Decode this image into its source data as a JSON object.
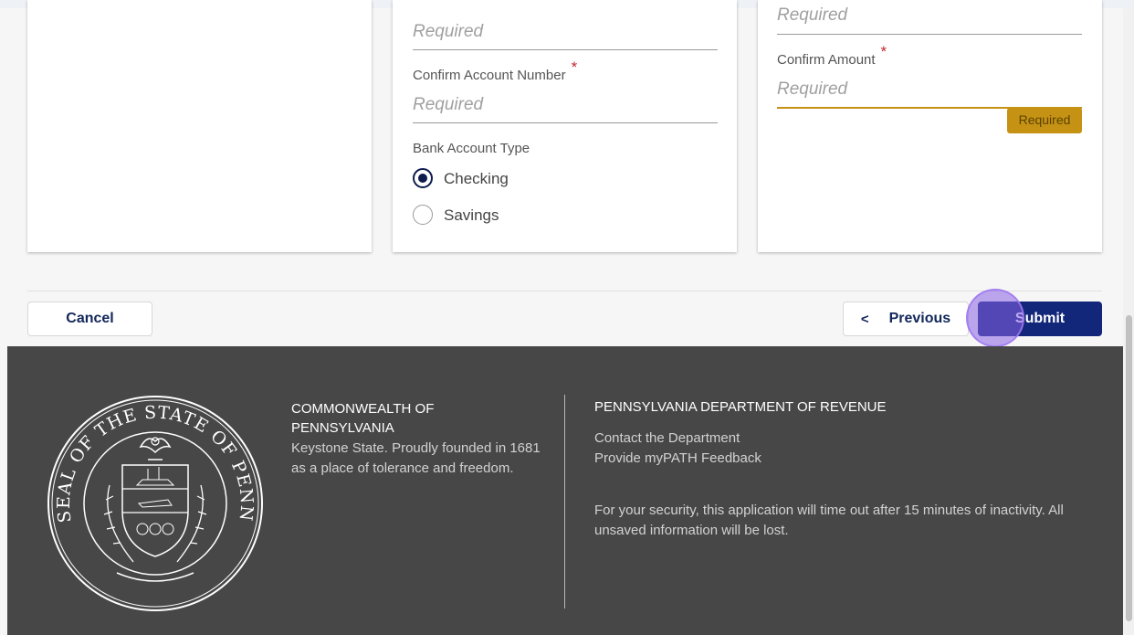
{
  "form": {
    "placeholder_required": "Required",
    "confirm_account_label": "Confirm Account Number",
    "required_star": "*",
    "account_type_label": "Bank Account Type",
    "account_types": [
      "Checking",
      "Savings"
    ],
    "account_type_selected": "Checking",
    "confirm_amount_label": "Confirm Amount",
    "error_badge": "Required"
  },
  "buttons": {
    "cancel": "Cancel",
    "previous": "Previous",
    "submit": "Submit"
  },
  "icons": {
    "previous": "chevron-left-icon",
    "seal": "pennsylvania-state-seal"
  },
  "footer": {
    "org_title": "COMMONWEALTH OF PENNSYLVANIA",
    "org_tagline": "Keystone State. Proudly founded in 1681 as a place of tolerance and freedom.",
    "dept_title": "PENNSYLVANIA DEPARTMENT OF REVENUE",
    "links": [
      "Contact the Department",
      "Provide myPATH Feedback"
    ],
    "security_notice": "For your security, this application will time out after 15 minutes of inactivity. All unsaved information will be lost.",
    "seal_text": "SEAL OF THE STATE OF PENNSYLVANIA"
  },
  "colors": {
    "primary": "#13277a",
    "warning": "#c69214",
    "footer_bg": "#474747",
    "required_star": "#c1272d"
  }
}
